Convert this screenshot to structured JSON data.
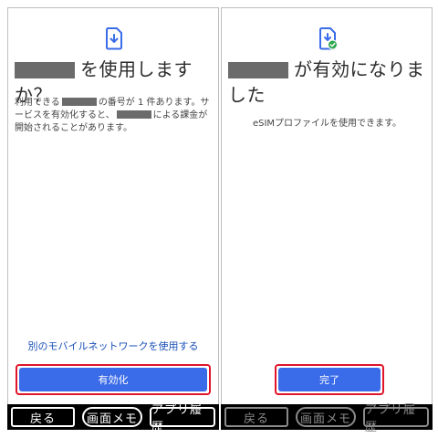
{
  "left_screen": {
    "title_suffix": "を使用しますか？",
    "desc_part1": "利用できる",
    "desc_part2": "の番号が 1 件あります。サービスを有効化すると、",
    "desc_part3": "による課金が開始されることがあります。",
    "link_label": "別のモバイルネットワークを使用する",
    "primary_button_label": "有効化"
  },
  "right_screen": {
    "title_suffix": "が有効になりました",
    "desc": "eSIMプロファイルを使用できます。",
    "primary_button_label": "完了"
  },
  "nav": {
    "back_label": "戻る",
    "memo_label": "画面メモ",
    "history_label": "アプリ履歴"
  },
  "colors": {
    "accent": "#3a6be8",
    "highlight_frame": "#e0142a",
    "link": "#1a4fb8",
    "success_badge": "#2fa84f"
  },
  "icons": {
    "left_header": "sim-download-icon",
    "right_header": "sim-download-check-icon"
  }
}
